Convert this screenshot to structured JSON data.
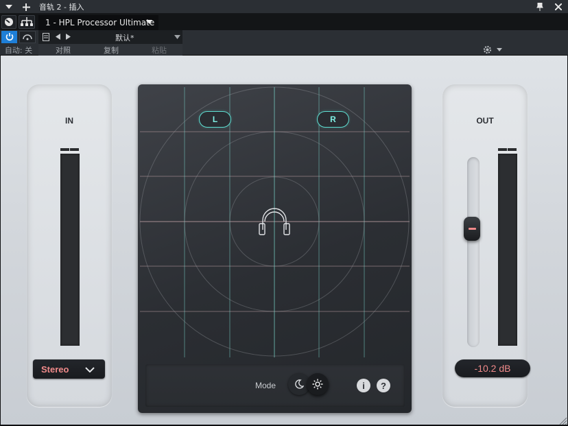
{
  "window": {
    "title": "音轨 2 - 插入"
  },
  "toolbar": {
    "preset_name": "1 - HPL Processor Ultimate",
    "preset_default": "默认*",
    "auto_label": "自动: 关",
    "compare_label": "对照",
    "copy_label": "复制",
    "paste_label": "粘贴"
  },
  "plugin": {
    "in_label": "IN",
    "out_label": "OUT",
    "channel_mode": "Stereo",
    "output_gain": "-10.2 dB",
    "left_label": "L",
    "right_label": "R",
    "mode_label": "Mode",
    "info_label": "i",
    "help_label": "?",
    "active_mode": "light"
  },
  "colors": {
    "accent_cyan": "#5ee0d3",
    "value_red": "#f08a8a",
    "power_blue": "#1e7fd8"
  }
}
